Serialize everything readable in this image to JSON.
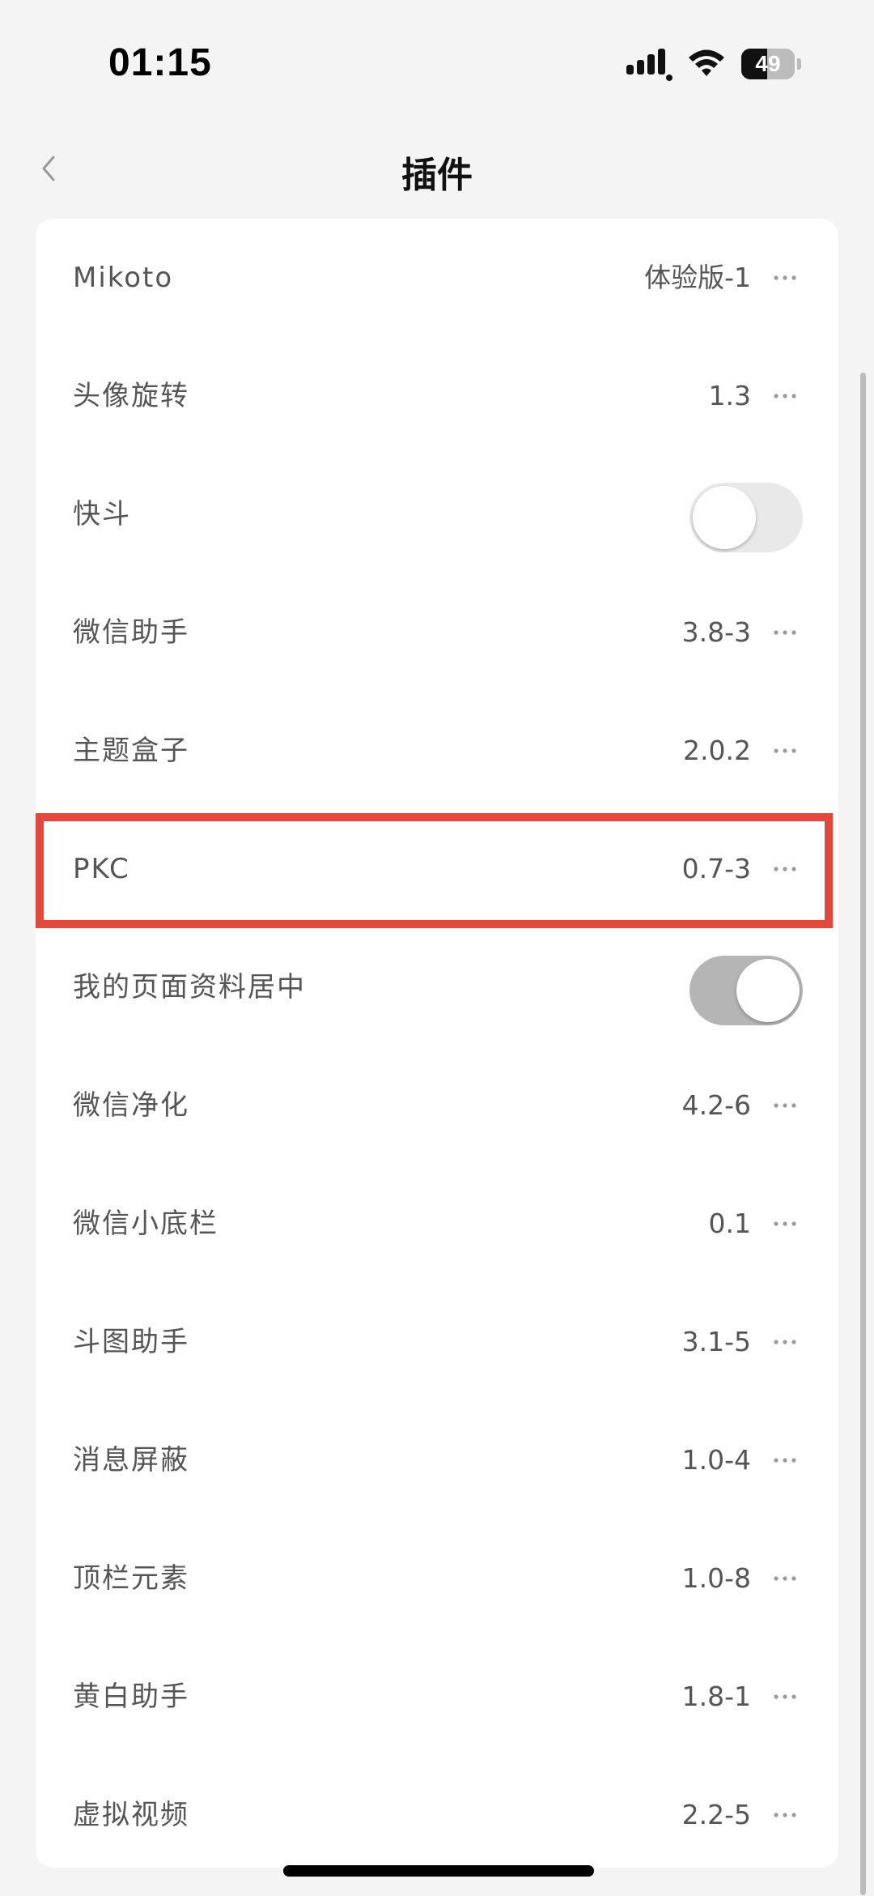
{
  "status": {
    "time": "01:15",
    "battery_level": "49",
    "battery_fraction": 0.49
  },
  "nav": {
    "title": "插件"
  },
  "plugins": [
    {
      "name": "Mikoto",
      "version": "体验版-1",
      "control": "more"
    },
    {
      "name": "头像旋转",
      "version": "1.3",
      "control": "more"
    },
    {
      "name": "快斗",
      "version": "",
      "control": "toggle",
      "enabled": false
    },
    {
      "name": "微信助手",
      "version": "3.8-3",
      "control": "more"
    },
    {
      "name": "主题盒子",
      "version": "2.0.2",
      "control": "more"
    },
    {
      "name": "PKC",
      "version": "0.7-3",
      "control": "more",
      "highlighted": true
    },
    {
      "name": "我的页面资料居中",
      "version": "",
      "control": "toggle",
      "enabled": true
    },
    {
      "name": "微信净化",
      "version": "4.2-6",
      "control": "more"
    },
    {
      "name": "微信小底栏",
      "version": "0.1",
      "control": "more"
    },
    {
      "name": "斗图助手",
      "version": "3.1-5",
      "control": "more"
    },
    {
      "name": "消息屏蔽",
      "version": "1.0-4",
      "control": "more"
    },
    {
      "name": "顶栏元素",
      "version": "1.0-8",
      "control": "more"
    },
    {
      "name": "黄白助手",
      "version": "1.8-1",
      "control": "more"
    },
    {
      "name": "虚拟视频",
      "version": "2.2-5",
      "control": "more"
    }
  ],
  "colors": {
    "highlight": "#e4473b",
    "toggle_on": "#b5b5b5",
    "toggle_off": "#e9e9e9"
  }
}
